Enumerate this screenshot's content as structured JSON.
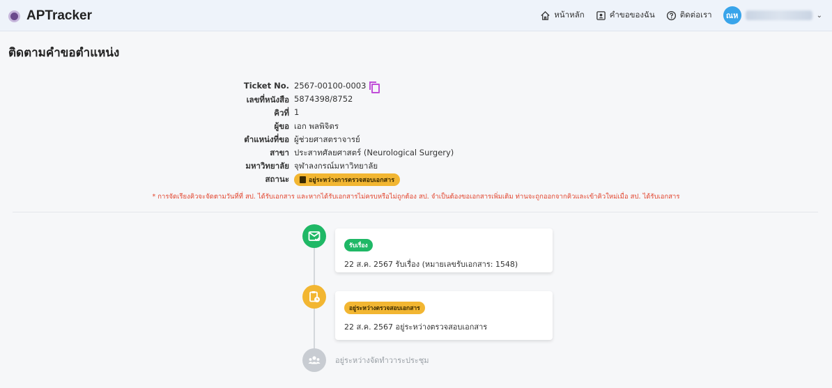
{
  "app": {
    "name": "APTracker"
  },
  "nav": {
    "home": "หน้าหลัก",
    "my_requests": "คำขอของฉัน",
    "contact": "ติดต่อเรา",
    "avatar_initials": "ณห"
  },
  "page": {
    "title": "ติดตามคำขอตำแหน่ง"
  },
  "ticket": {
    "rows": [
      {
        "label": "Ticket No.",
        "value": "2567-00100-0003"
      },
      {
        "label": "เลขที่หนังสือ",
        "value": "5874398/8752"
      },
      {
        "label": "คิวที่",
        "value": "1"
      },
      {
        "label": "ผู้ขอ",
        "value": "เอก พลพิจิตร"
      },
      {
        "label": "ตำแหน่งที่ขอ",
        "value": "ผู้ช่วยศาสตราจารย์"
      },
      {
        "label": "สาขา",
        "value": "ประสาทศัลยศาสตร์ (Neurological Surgery)"
      },
      {
        "label": "มหาวิทยาลัย",
        "value": "จุฬาลงกรณ์มหาวิทยาลัย"
      },
      {
        "label": "สถานะ",
        "value": "อยู่ระหว่างการตรวจสอบเอกสาร"
      }
    ]
  },
  "notice": "* การจัดเรียงคิวจะจัดตามวันที่ที่ สป. ได้รับเอกสาร และหากได้รับเอกสารไม่ครบหรือไม่ถูกต้อง สป. จำเป็นต้องขอเอกสารเพิ่มเติม ท่านจะถูกออกจากคิวและเข้าคิวใหม่เมื่อ สป. ได้รับเอกสาร",
  "timeline": {
    "steps": [
      {
        "badge": "รับเรื่อง",
        "text": "22 ส.ค. 2567 รับเรื่อง (หมายเลขรับเอกสาร: 1548)",
        "color": "#1fb866"
      },
      {
        "badge": "อยู่ระหว่างตรวจสอบเอกสาร",
        "text": "22 ส.ค. 2567 อยู่ระหว่างตรวจสอบเอกสาร",
        "color": "#f2b632"
      },
      {
        "label": "อยู่ระหว่างจัดทำวาระประชุม",
        "color": "#c8ccd2"
      }
    ]
  }
}
